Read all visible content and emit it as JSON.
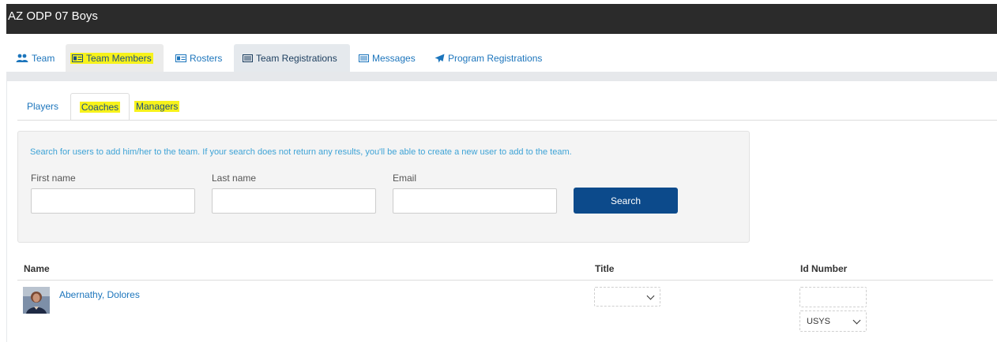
{
  "header": {
    "title": "AZ ODP 07 Boys"
  },
  "nav_tabs": [
    {
      "label": "Team",
      "icon": "users-icon"
    },
    {
      "label": "Team Members",
      "icon": "id-card-icon"
    },
    {
      "label": "Rosters",
      "icon": "id-card-icon"
    },
    {
      "label": "Team Registrations",
      "icon": "list-icon"
    },
    {
      "label": "Messages",
      "icon": "list-icon"
    },
    {
      "label": "Program Registrations",
      "icon": "paper-plane-icon"
    }
  ],
  "sub_tabs": [
    {
      "label": "Players"
    },
    {
      "label": "Coaches"
    },
    {
      "label": "Managers"
    }
  ],
  "search": {
    "hint": "Search for users to add him/her to the team. If your search does not return any results, you'll be able to create a new user to add to the team.",
    "first_name_label": "First name",
    "last_name_label": "Last name",
    "email_label": "Email",
    "first_name_value": "",
    "last_name_value": "",
    "email_value": "",
    "button_label": "Search"
  },
  "table": {
    "columns": [
      "Name",
      "Title",
      "Id Number"
    ],
    "rows": [
      {
        "name": "Abernathy, Dolores",
        "title": "",
        "id_number": "",
        "id_type": "USYS"
      }
    ]
  },
  "colors": {
    "link": "#1c75bc",
    "primary_button": "#0c4a8b",
    "highlight": "#f7f21b",
    "titlebar": "#2b2b2b"
  }
}
